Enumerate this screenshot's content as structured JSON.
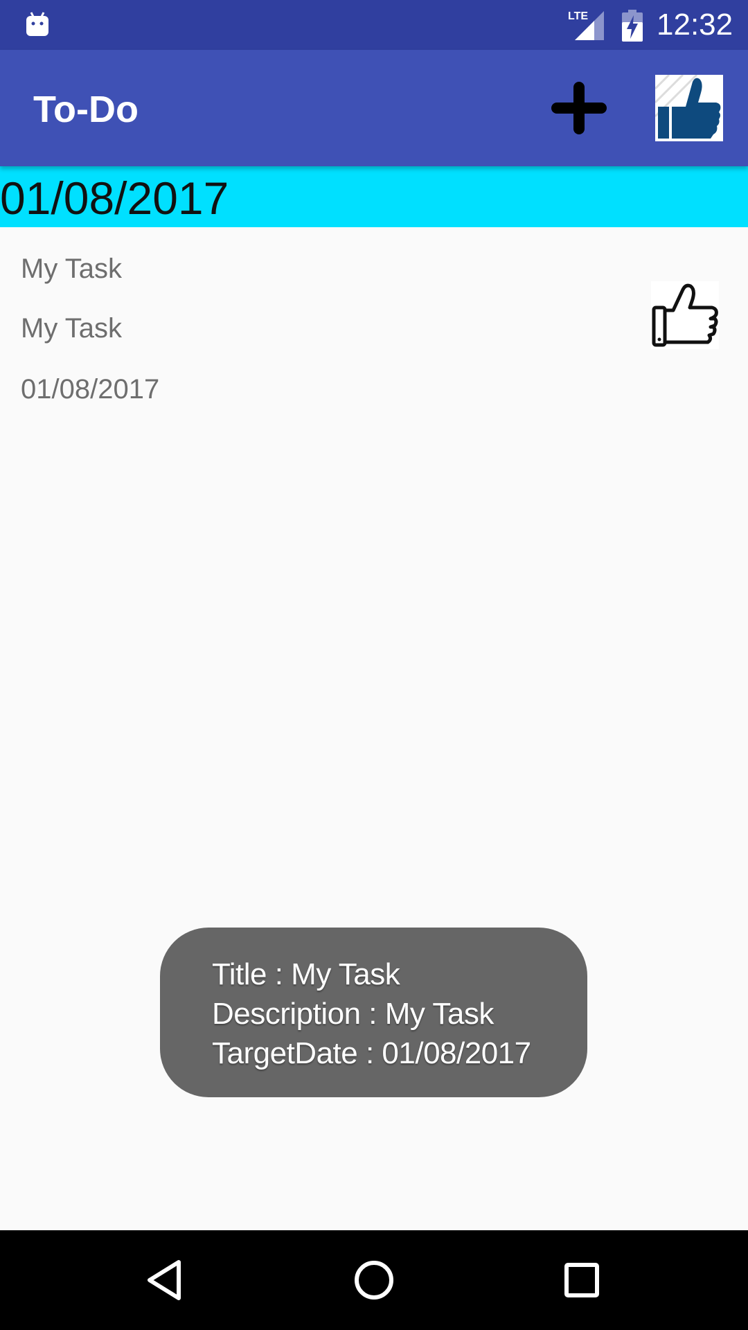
{
  "status_bar": {
    "time": "12:32",
    "network_label": "LTE",
    "icons": [
      "android-debug-icon",
      "lte-signal-icon",
      "battery-charging-icon"
    ]
  },
  "app_bar": {
    "title": "To-Do",
    "actions": [
      "add-icon",
      "thumbs-up-icon"
    ]
  },
  "date_header": {
    "date": "01/08/2017"
  },
  "task": {
    "title": "My Task",
    "description": "My Task",
    "target_date": "01/08/2017",
    "icon": "thumbs-up-outline-icon"
  },
  "toast": {
    "line1": "Title : My Task",
    "line2": "Description : My Task",
    "line3": "TargetDate : 01/08/2017"
  },
  "nav_bar": {
    "buttons": [
      "back-icon",
      "home-icon",
      "recents-icon"
    ]
  },
  "colors": {
    "status_bar": "#303f9f",
    "app_bar": "#3f51b5",
    "date_header": "#00e0ff",
    "toast": "#666666",
    "like_icon": "#0e4a7e"
  }
}
